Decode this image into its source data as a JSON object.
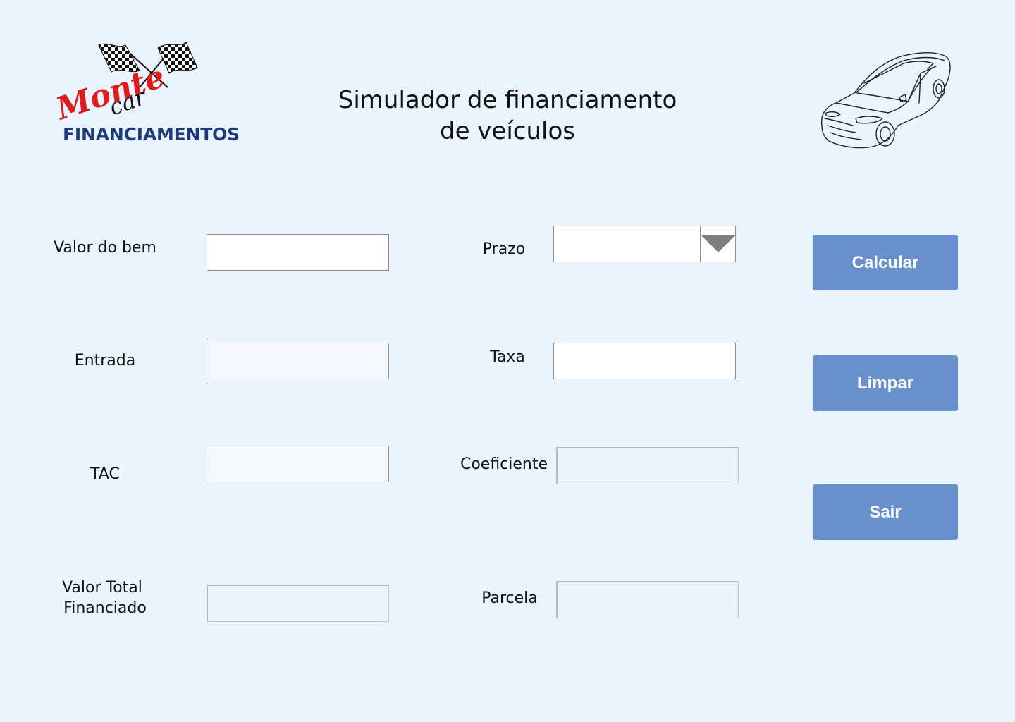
{
  "logo": {
    "script_text": "Monte",
    "script_text_2": "car",
    "wordmark": "FINANCIAMENTOS",
    "flag_icon": "checkered-flags-icon",
    "colors": {
      "script": "#e01b1b",
      "wordmark": "#1f3a78"
    }
  },
  "header": {
    "title_line1": "Simulador de financiamento",
    "title_line2": "de veículos",
    "car_icon": "car-outline-icon"
  },
  "form": {
    "valor_do_bem": {
      "label": "Valor do bem",
      "value": ""
    },
    "entrada": {
      "label": "Entrada",
      "value": ""
    },
    "tac": {
      "label": "TAC",
      "value": ""
    },
    "valor_total_financiado": {
      "label_line1": "Valor Total",
      "label_line2": "Financiado",
      "value": ""
    },
    "prazo": {
      "label": "Prazo",
      "value": "",
      "dropdown_icon": "triangle-down-icon"
    },
    "taxa": {
      "label": "Taxa",
      "value": ""
    },
    "coeficiente": {
      "label": "Coeficiente",
      "value": ""
    },
    "parcela": {
      "label": "Parcela",
      "value": ""
    }
  },
  "actions": {
    "calcular": "Calcular",
    "limpar": "Limpar",
    "sair": "Sair"
  },
  "colors": {
    "background": "#eaf4fe",
    "button": "#6890cc",
    "button_text": "#ffffff",
    "readonly_field": "#e9f3fc"
  }
}
